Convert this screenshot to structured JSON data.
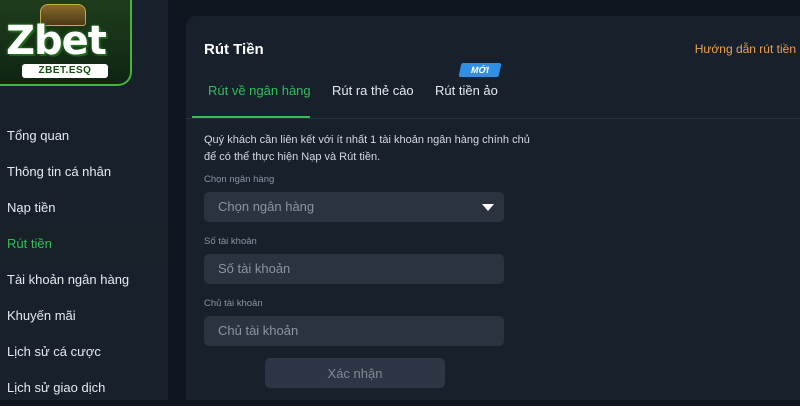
{
  "brand": {
    "logo_text": "Zbet",
    "logo_subtext": "ZBET.ESQ",
    "accent": "#2fbf5a",
    "logo_border": "#46b43c"
  },
  "sidebar": {
    "items": [
      {
        "label": "Tổng quan",
        "active": false
      },
      {
        "label": "Thông tin cá nhân",
        "active": false
      },
      {
        "label": "Nạp tiền",
        "active": false
      },
      {
        "label": "Rút tiền",
        "active": true
      },
      {
        "label": "Tài khoản ngân hàng",
        "active": false
      },
      {
        "label": "Khuyến mãi",
        "active": false
      },
      {
        "label": "Lịch sử cá cược",
        "active": false
      },
      {
        "label": "Lịch sử giao dịch",
        "active": false
      }
    ]
  },
  "panel": {
    "title": "Rút Tiền",
    "guide_link": "Hướng dẫn rút tiền",
    "guide_color": "#f0a24a",
    "tabs": [
      {
        "label": "Rút về ngân hàng",
        "active": true
      },
      {
        "label": "Rút ra thẻ cào",
        "active": false
      },
      {
        "label": "Rút tiền ảo",
        "active": false,
        "badge": "MỚI"
      }
    ],
    "notice": "Quý khách cần liên kết với ít nhất 1 tài khoản ngân hàng chính chủ để có thể thực hiện Nạp và Rút tiền.",
    "form": {
      "bank_label": "Chọn ngân hàng",
      "bank_placeholder": "Chọn ngân hàng",
      "account_number_label": "Số tài khoản",
      "account_number_placeholder": "Số tài khoản",
      "account_holder_label": "Chủ tài khoản",
      "account_holder_placeholder": "Chủ tài khoản",
      "submit_label": "Xác nhận"
    }
  }
}
